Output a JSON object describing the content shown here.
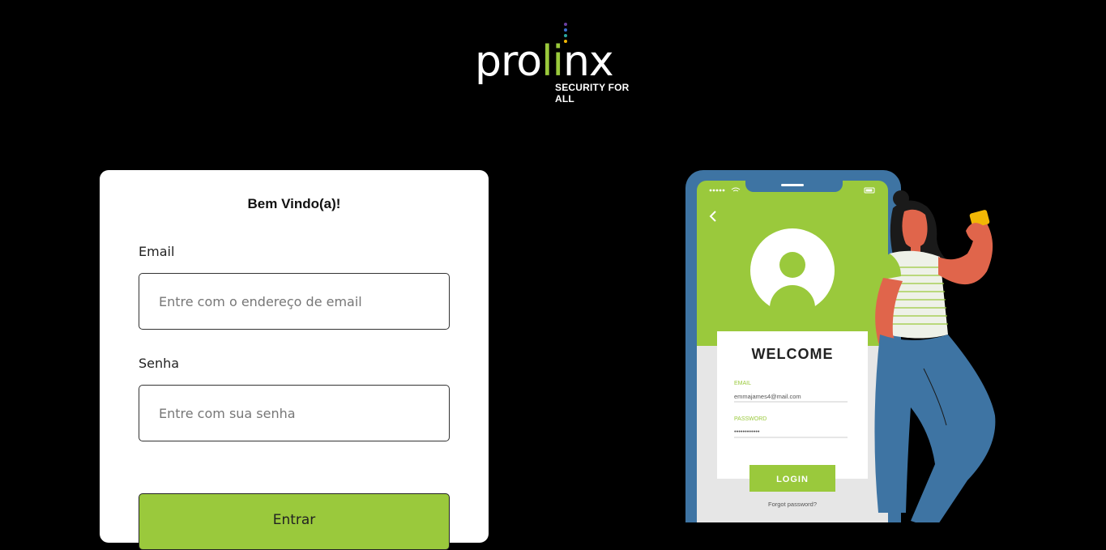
{
  "logo": {
    "word_left": "pro",
    "word_mid": "li",
    "word_right": "nx",
    "tagline": "SECURITY FOR ALL",
    "dot_colors": [
      "#6a3fa0",
      "#3b6ecf",
      "#2aa6a0",
      "#f2b705"
    ]
  },
  "login": {
    "title": "Bem Vindo(a)!",
    "email_label": "Email",
    "email_placeholder": "Entre com o endereço de email",
    "password_label": "Senha",
    "password_placeholder": "Entre com sua senha",
    "submit_label": "Entrar"
  },
  "illustration": {
    "welcome": "WELCOME",
    "email_label": "EMAIL",
    "email_value": "emmajames4@mail.com",
    "password_label": "PASSWORD",
    "password_value": "••••••••••••",
    "login_button": "LOGIN",
    "forgot": "Forgot password?"
  },
  "colors": {
    "accent": "#9ac93c",
    "background": "#000000",
    "phone_frame": "#3e74a3"
  }
}
